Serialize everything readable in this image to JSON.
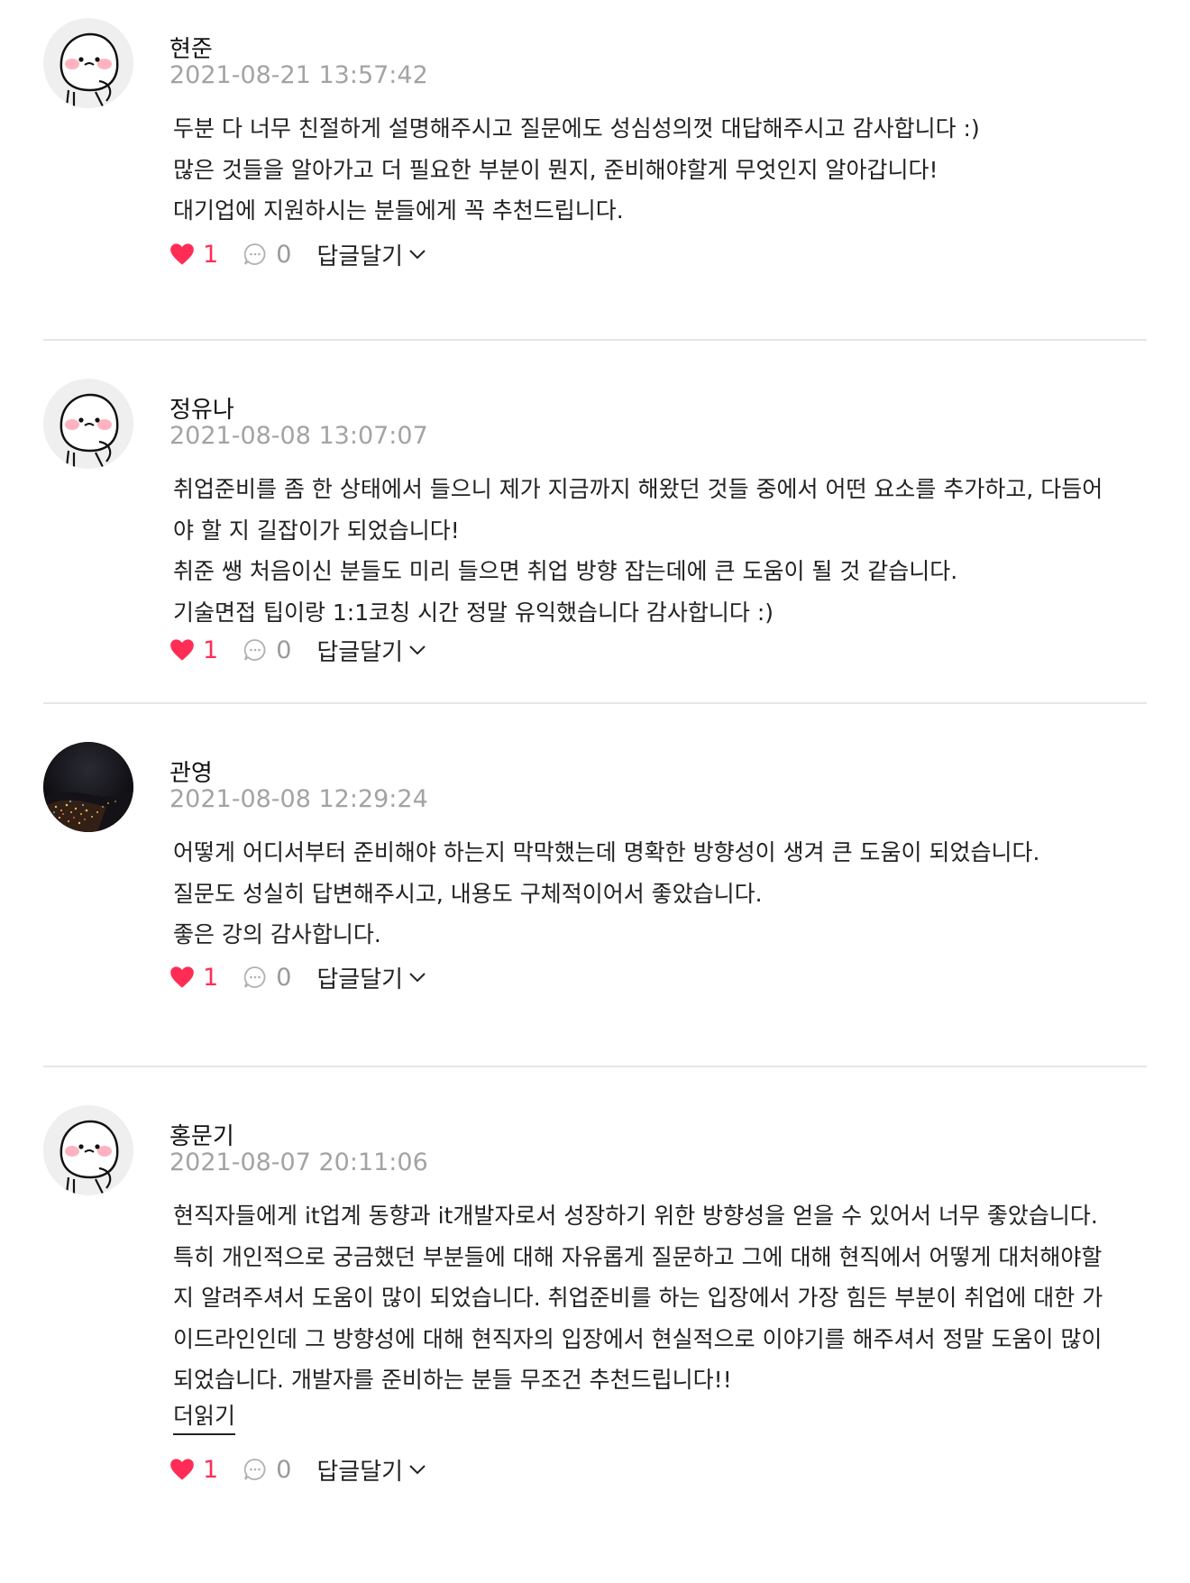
{
  "reviews": [
    {
      "author": "현준",
      "date": "2021-08-21 13:57:42",
      "lines": [
        "두분 다 너무 친절하게 설명해주시고 질문에도 성심성의껏 대답해주시고 감사합니다 :)",
        "많은 것들을 알아가고 더 필요한 부분이 뭔지, 준비해야할게 무엇인지 알아갑니다!",
        "대기업에 지원하시는 분들에게 꼭 추천드립니다."
      ],
      "likes": "1",
      "comments": "0",
      "reply_label": "답글달기",
      "avatar": "default-character"
    },
    {
      "author": "정유나",
      "date": "2021-08-08 13:07:07",
      "lines": [
        "취업준비를 좀 한 상태에서 들으니 제가 지금까지 해왔던 것들 중에서 어떤 요소를 추가하고, 다듬어",
        "야 할 지 길잡이가 되었습니다!",
        "취준 쌩 처음이신 분들도 미리 들으면 취업 방향 잡는데에 큰 도움이 될 것 같습니다.",
        "기술면접 팁이랑 1:1코칭 시간 정말 유익했습니다 감사합니다 :)"
      ],
      "likes": "1",
      "comments": "0",
      "reply_label": "답글달기",
      "avatar": "default-character"
    },
    {
      "author": "관영",
      "date": "2021-08-08 12:29:24",
      "lines": [
        "어떻게 어디서부터 준비해야 하는지 막막했는데 명확한 방향성이 생겨 큰 도움이 되었습니다.",
        "질문도 성실히 답변해주시고, 내용도 구체적이어서 좋았습니다.",
        "좋은 강의 감사합니다."
      ],
      "likes": "1",
      "comments": "0",
      "reply_label": "답글달기",
      "avatar": "night-city-photo"
    },
    {
      "author": "홍문기",
      "date": "2021-08-07 20:11:06",
      "lines": [
        "현직자들에게 it업계 동향과 it개발자로서 성장하기 위한 방향성을 얻을 수 있어서 너무 좋았습니다.",
        "특히 개인적으로 궁금했던 부분들에 대해 자유롭게 질문하고 그에 대해 현직에서 어떻게 대처해야할",
        "지 알려주셔서 도움이 많이 되었습니다. 취업준비를 하는 입장에서 가장 힘든 부분이 취업에 대한 가",
        "이드라인인데 그 방향성에 대해 현직자의 입장에서 현실적으로 이야기를 해주셔서 정말 도움이 많이",
        "되었습니다. 개발자를 준비하는 분들 무조건 추천드립니다!!"
      ],
      "more_label": "더읽기",
      "likes": "1",
      "comments": "0",
      "reply_label": "답글달기",
      "avatar": "default-character"
    }
  ],
  "colors": {
    "like": "#ff2d55",
    "muted": "#a3a3a3",
    "divider": "#e6e6e6",
    "cheek": "#ffb3c1"
  }
}
